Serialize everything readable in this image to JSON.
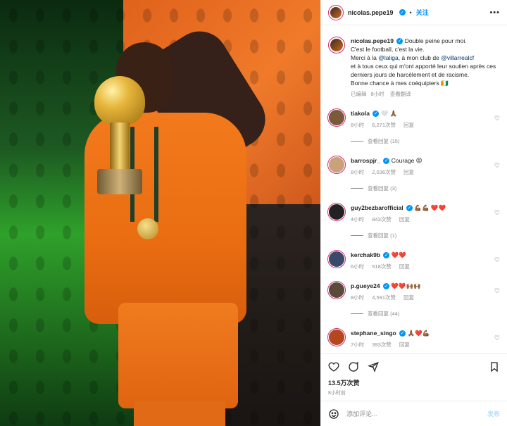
{
  "post": {
    "author": "nicolas.pepe19",
    "follow_label": "关注",
    "caption_lines": [
      "Double peine pour moi.",
      "C'est le football, c'est la vie.",
      "Merci à la",
      "@laliga",
      ", à mon club de",
      "@villarrealcf",
      "et à tous ceux qui m'ont apporté leur soutien après ces derniers jours de harcèlement et de racisme.",
      "Bonne chance à mes coéquipiers 🇨🇮"
    ],
    "caption_edited": "已编辑",
    "caption_time": "8小时",
    "caption_translate": "查看翻译"
  },
  "comments": [
    {
      "user": "tiakola",
      "text": "🤍 🙏🏾",
      "time": "8小时",
      "likes": "6,271次赞",
      "reply": "回复",
      "view_replies": "查看回复 (15)",
      "color": "#7a5a3a"
    },
    {
      "user": "barrospjr_",
      "text": "Courage 😡",
      "time": "8小时",
      "likes": "2,036次赞",
      "reply": "回复",
      "view_replies": "查看回复 (3)",
      "color": "#c9a27a"
    },
    {
      "user": "guy2bezbarofficial",
      "text": "💪🏾💪🏾 ❤️❤️",
      "time": "4小时",
      "likes": "843次赞",
      "reply": "回复",
      "view_replies": "查看回复 (1)",
      "color": "#222222"
    },
    {
      "user": "kerchak9b",
      "text": "❤️❤️",
      "time": "6小时",
      "likes": "518次赞",
      "reply": "回复",
      "view_replies": "",
      "color": "#3b4a6b"
    },
    {
      "user": "p.gueye24",
      "text": "❤️❤️🙌🏾🙌🏾",
      "time": "8小时",
      "likes": "4,591次赞",
      "reply": "回复",
      "view_replies": "查看回复 (44)",
      "color": "#5a4a3a"
    },
    {
      "user": "stephane_singo",
      "text": "🙏🏾❤️💪🏾",
      "time": "7小时",
      "likes": "393次赞",
      "reply": "回复",
      "view_replies": "",
      "color": "#b5471f"
    }
  ],
  "actions": {
    "likes": "13.5万次赞",
    "time": "8小时前"
  },
  "add_comment": {
    "placeholder": "添加评论...",
    "post_label": "发布"
  },
  "icons": {
    "like": "heart-icon",
    "comment": "comment-icon",
    "share": "share-icon",
    "save": "bookmark-icon",
    "emoji": "emoji-icon",
    "more": "more-icon"
  },
  "colors": {
    "accent": "#0095f6",
    "verified": "#0095f6",
    "mention": "#00376b",
    "muted": "#8e8e8e"
  }
}
